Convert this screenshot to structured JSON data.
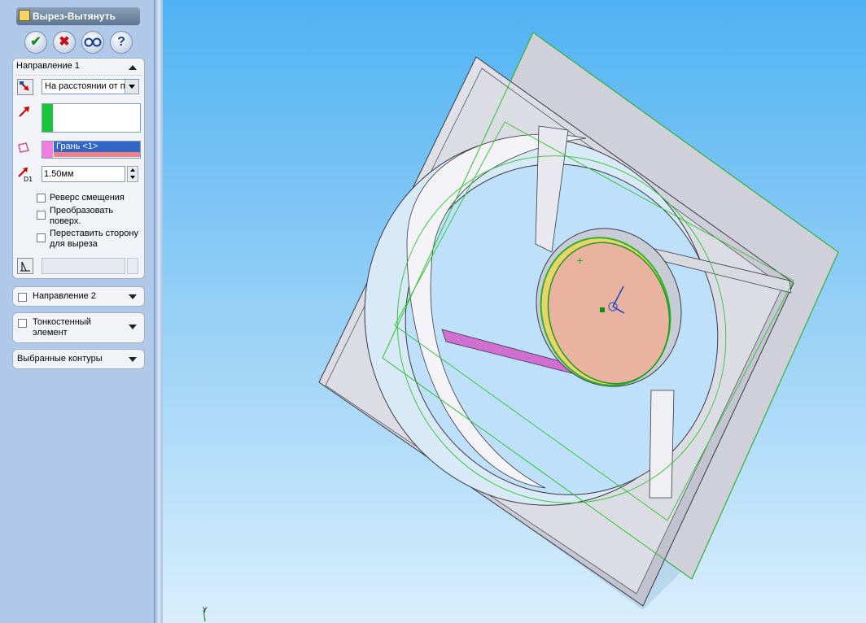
{
  "feature_title": "Вырез-Вытянуть",
  "buttons": {
    "ok": "✔",
    "cancel": "✖",
    "preview": "👓",
    "help": "?"
  },
  "direction1": {
    "header": "Направление 1",
    "end_condition": "На расстоянии от п",
    "face_item": "Грань <1>",
    "offset_value": "1.50мм",
    "offset_icon_label": "D1",
    "reverse_offset": "Реверс смещения",
    "transform_surface": "Преобразовать поверх.",
    "flip_side": "Переставить сторону для выреза"
  },
  "direction2": {
    "header": "Направление 2"
  },
  "thin_feature": {
    "header": "Тонкостенный элемент"
  },
  "selected_contours": {
    "header": "Выбранные контуры"
  },
  "triad": {
    "y_label": "Y"
  }
}
